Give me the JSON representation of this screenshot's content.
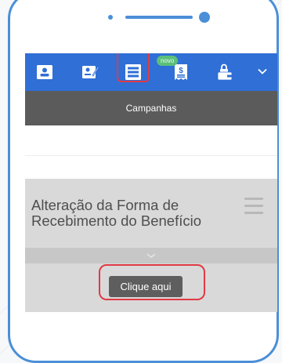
{
  "toolbar": {
    "icons": [
      {
        "name": "profile-card-icon"
      },
      {
        "name": "signature-icon"
      },
      {
        "name": "campaigns-list-icon"
      },
      {
        "name": "receipt-money-icon"
      },
      {
        "name": "lock-wallet-icon"
      },
      {
        "name": "chevron-down-icon"
      }
    ],
    "badge_label": "novo"
  },
  "header": {
    "title": "Campanhas"
  },
  "campaign_card": {
    "title": "Alteração da Forma de Recebimento do Benefício",
    "cta_label": "Clique aqui"
  },
  "colors": {
    "toolbar_bg": "#2f6fd6",
    "titlebar_bg": "#5b5b5b",
    "highlight": "#e03a44",
    "phone_frame": "#4a8fd8"
  }
}
